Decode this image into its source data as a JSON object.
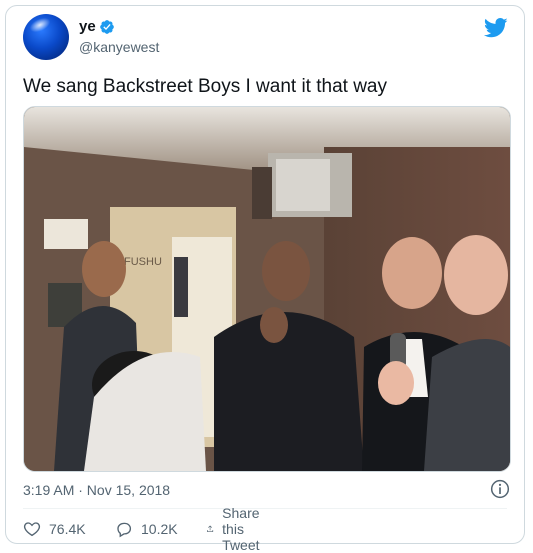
{
  "author": {
    "name": "ye",
    "handle": "@kanyewest",
    "verified": true
  },
  "tweet": {
    "text": "We sang Backstreet Boys I want it that way",
    "timestamp": "3:19 AM · Nov 15, 2018",
    "photo_description_icon": "photo",
    "photo_sign_text": "FUSHU"
  },
  "actions": {
    "likes": "76.4K",
    "replies": "10.2K",
    "share_label": "Share this Tweet"
  },
  "icons": {
    "brand": "twitter-bird-icon",
    "verified": "verified-badge-icon",
    "info": "info-icon",
    "like": "heart-icon",
    "reply": "reply-icon",
    "share": "share-icon"
  },
  "colors": {
    "brand": "#1d9bf0",
    "secondary_text": "#536471",
    "border": "#cfd9de"
  }
}
